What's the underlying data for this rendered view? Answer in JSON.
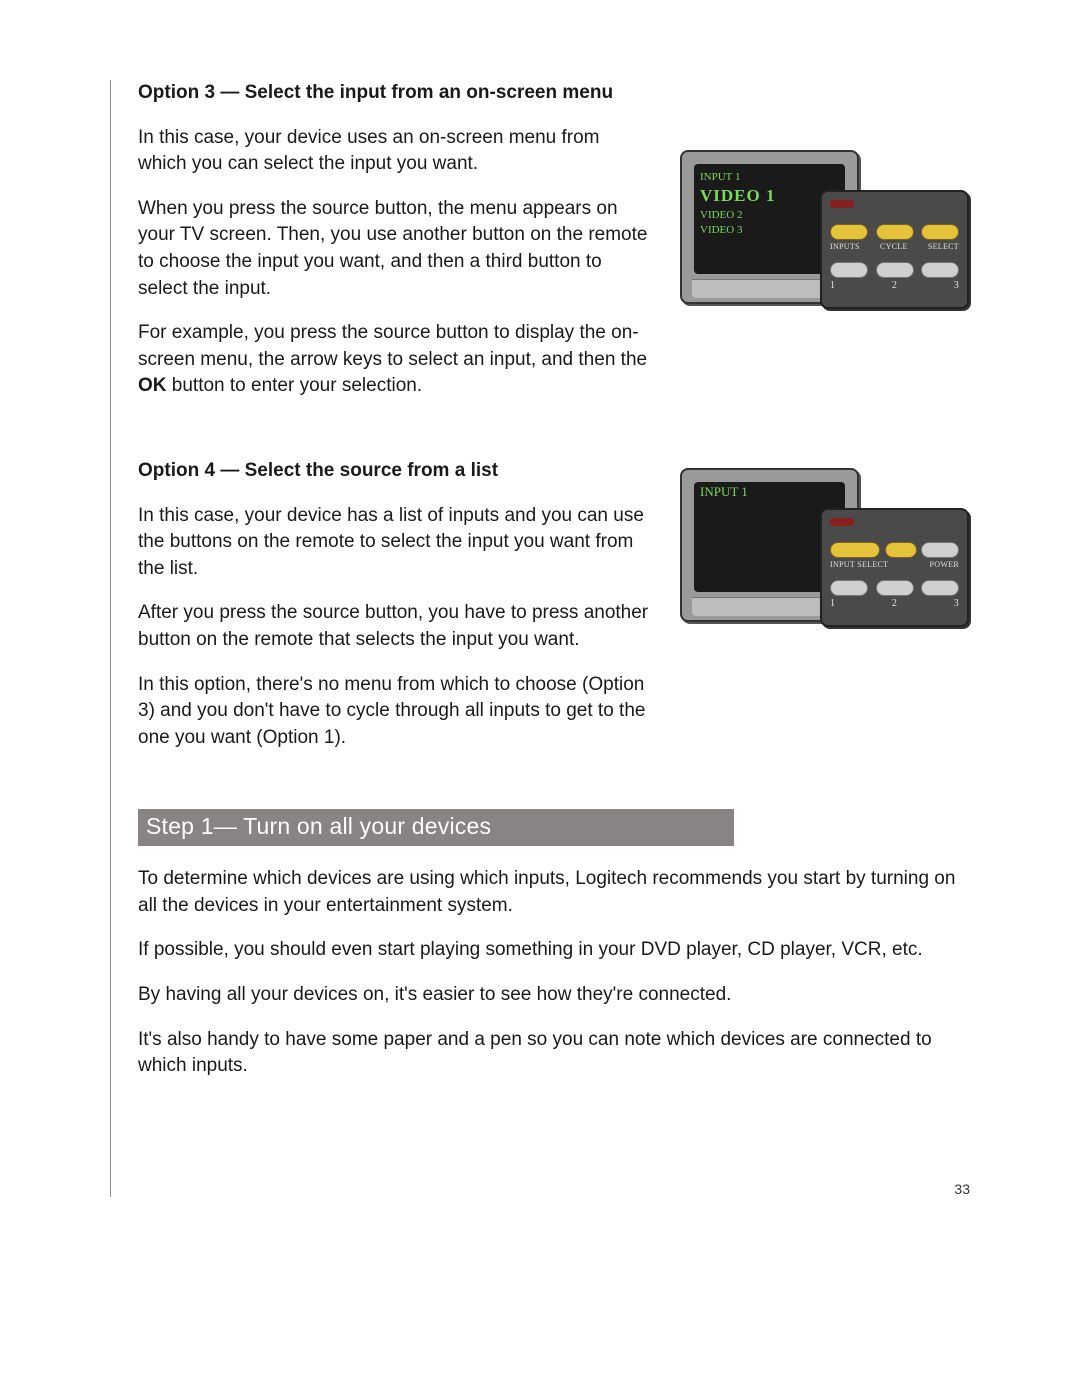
{
  "option3": {
    "heading": "Option 3 — Select the input from an on-screen menu",
    "p1": "In this case, your device uses an on-screen menu from which you can select the input you want.",
    "p2": "When you press the source button, the menu appears on your TV screen. Then, you use another button on the remote to choose the input you want, and then a third button to select the input.",
    "p3_a": "For example, you press the source button to display the on-screen menu, the arrow keys to select an input, and then the ",
    "p3_bold": "OK",
    "p3_b": " button to enter your selection."
  },
  "option4": {
    "heading": "Option 4 — Select the source from a list",
    "p1": "In this case, your device has a list of inputs and you can use the buttons on the remote to select the input you want from the list.",
    "p2": "After you press the source button, you have to press another button on the remote that selects the input you want.",
    "p3": "In this option, there's no menu from which to choose (Option 3) and you don't have to cycle through all inputs to get to the one you want (Option 1)."
  },
  "step": {
    "bar": "Step 1— Turn on all your devices",
    "p1": "To determine which devices are using which inputs, Logitech recommends you start by turning on all the devices in your entertainment system.",
    "p2": "If possible, you should even start playing something in your DVD player, CD player, VCR, etc.",
    "p3": "By having all your devices on, it's easier to see how they're connected.",
    "p4": "It's also handy to have some paper and a pen so you can note which devices are connected to which inputs."
  },
  "illus1": {
    "menu_line1": "INPUT 1",
    "menu_sel": "VIDEO 1",
    "menu_line3": "VIDEO 2",
    "menu_line4": "VIDEO 3",
    "label1": "INPUTS",
    "label2": "CYCLE",
    "label3": "SELECT",
    "num1": "1",
    "num2": "2",
    "num3": "3"
  },
  "illus2": {
    "menu_line": "INPUT 1",
    "label1": "INPUT SELECT",
    "label2": "POWER",
    "num1": "1",
    "num2": "2",
    "num3": "3"
  },
  "page_number": "33"
}
